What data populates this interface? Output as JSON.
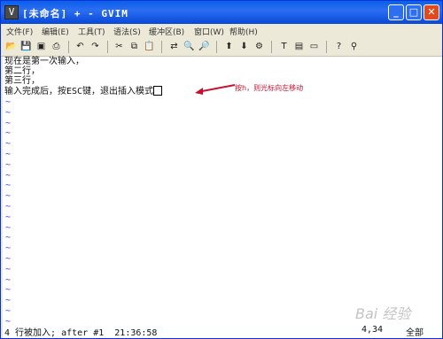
{
  "window": {
    "title": "[未命名] + - GVIM",
    "icon_name": "vim-icon"
  },
  "menubar": {
    "items": [
      "文件(F)",
      "编辑(E)",
      "工具(T)",
      "语法(S)",
      "缓冲区(B)",
      "窗口(W)",
      "帮助(H)"
    ]
  },
  "toolbar": {
    "icons": [
      "open-icon",
      "save-icon",
      "save-all-icon",
      "print-icon",
      "undo-icon",
      "redo-icon",
      "cut-icon",
      "copy-icon",
      "paste-icon",
      "replace-icon",
      "find-next-icon",
      "find-prev-icon",
      "load-session-icon",
      "save-session-icon",
      "run-script-icon",
      "make-icon",
      "shell-icon",
      "tags-icon",
      "help-icon",
      "find-help-icon"
    ]
  },
  "editor": {
    "lines": [
      "现在是第一次输入，",
      "第二行，",
      "第三行，",
      "输入完成后，按ESC键，退出插入模式"
    ],
    "tilde": "~",
    "annotation": "按h，则光标向左移动",
    "annotation_color": "#c8102e"
  },
  "status": {
    "message": "4 行被加入; after #1  21:36:58",
    "position": "4,34",
    "percent": "全部"
  },
  "watermark": "Bai 经验"
}
